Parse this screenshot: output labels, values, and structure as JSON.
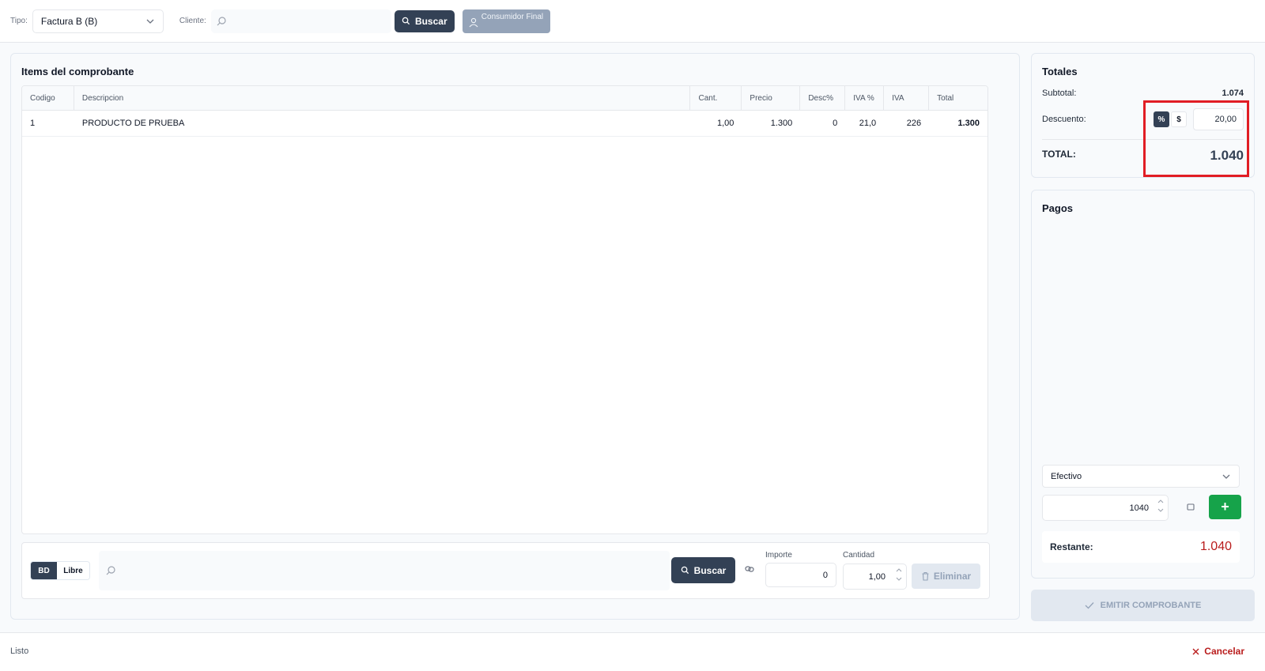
{
  "header": {
    "tipo_label": "Tipo:",
    "tipo_value": "Factura B (B)",
    "cliente_label": "Cliente:",
    "buscar_label": "Buscar",
    "consumidor_label": "Consumidor Final"
  },
  "items": {
    "title": "Items del comprobante",
    "columns": [
      "Codigo",
      "Descripcion",
      "Cant.",
      "Precio",
      "Desc%",
      "IVA %",
      "IVA",
      "Total"
    ],
    "rows": [
      {
        "codigo": "1",
        "descripcion": "PRODUCTO DE PRUEBA",
        "cant": "1,00",
        "precio": "1.300",
        "desc": "0",
        "iva_pct": "21,0",
        "iva": "226",
        "total": "1.300"
      }
    ]
  },
  "entry": {
    "mode_bd": "BD",
    "mode_libre": "Libre",
    "buscar_label": "Buscar",
    "importe_label": "Importe",
    "importe_value": "0",
    "cantidad_label": "Cantidad",
    "cantidad_value": "1,00",
    "eliminar_label": "Eliminar"
  },
  "totales": {
    "title": "Totales",
    "subtotal_label": "Subtotal:",
    "subtotal_value": "1.074",
    "descuento_label": "Descuento:",
    "pct_symbol": "%",
    "dollar_symbol": "$",
    "descuento_value": "20,00",
    "total_label": "TOTAL:",
    "total_value": "1.040"
  },
  "pagos": {
    "title": "Pagos",
    "method_value": "Efectivo",
    "amount_value": "1040",
    "add_symbol": "+",
    "restante_label": "Restante:",
    "restante_value": "1.040"
  },
  "emitir_label": "EMITIR COMPROBANTE",
  "status": {
    "text": "Listo",
    "cancel_label": "Cancelar"
  },
  "colors": {
    "accent_dark": "#334155",
    "success": "#16a34a",
    "danger": "#b91c1c",
    "highlight": "#e11d24"
  }
}
